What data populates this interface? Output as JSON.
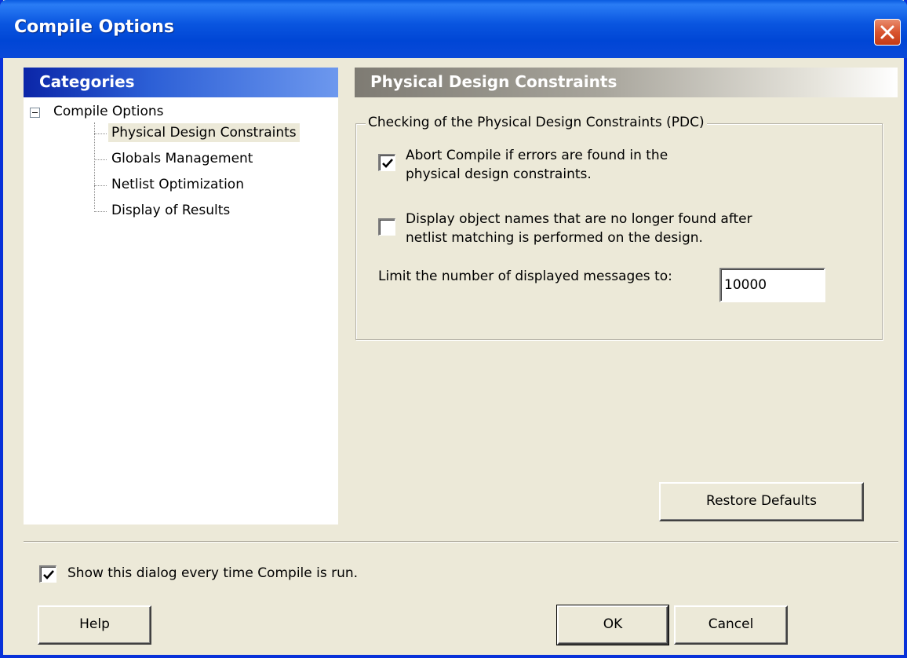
{
  "window": {
    "title": "Compile Options"
  },
  "categories": {
    "header": "Categories",
    "root": "Compile Options",
    "items": [
      {
        "label": "Physical Design Constraints",
        "selected": true
      },
      {
        "label": "Globals Management",
        "selected": false
      },
      {
        "label": "Netlist Optimization",
        "selected": false
      },
      {
        "label": "Display of Results",
        "selected": false
      }
    ]
  },
  "panel": {
    "header": "Physical Design Constraints",
    "group_title": "Checking of the Physical Design Constraints (PDC)",
    "option_abort": {
      "line1": "Abort Compile if errors are found in the",
      "line2": "physical design constraints.",
      "checked": true
    },
    "option_display_names": {
      "line1": "Display object names that are no longer found after",
      "line2": "netlist matching is performed on the design.",
      "checked": false
    },
    "limit_label": "Limit the number of displayed messages to:",
    "limit_value": "10000",
    "restore_defaults": "Restore Defaults"
  },
  "footer": {
    "show_dialog_label": "Show this dialog every time Compile is run.",
    "show_dialog_checked": true,
    "help": "Help",
    "ok": "OK",
    "cancel": "Cancel"
  }
}
